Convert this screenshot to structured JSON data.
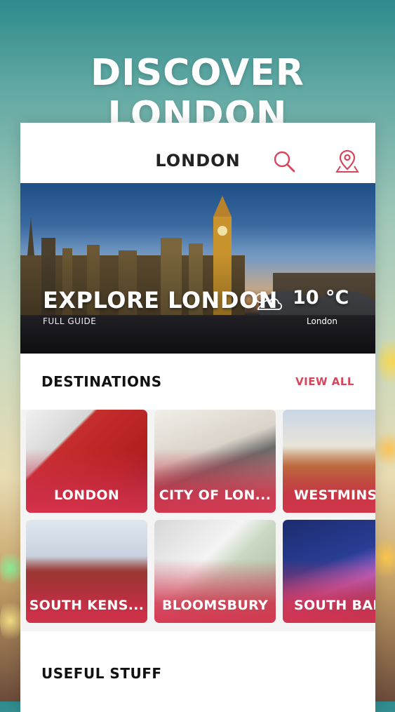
{
  "promo": {
    "title": "DISCOVER LONDON"
  },
  "appbar": {
    "title": "LONDON",
    "search_icon": "search-icon",
    "map_icon": "map-pin-icon"
  },
  "hero": {
    "title": "EXPLORE LONDON",
    "subtitle": "FULL GUIDE",
    "weather": {
      "temp": "10 °C",
      "city": "London",
      "icon": "cloud-sun-icon"
    }
  },
  "destinations": {
    "title": "DESTINATIONS",
    "view_all": "VIEW ALL",
    "items": [
      {
        "label": "LONDON"
      },
      {
        "label": "CITY OF LON..."
      },
      {
        "label": "WESTMINST"
      },
      {
        "label": "SOUTH KENS..."
      },
      {
        "label": "BLOOMSBURY"
      },
      {
        "label": "SOUTH BAN"
      }
    ]
  },
  "useful": {
    "title": "USEFUL STUFF"
  },
  "colors": {
    "accent": "#d6455b",
    "title_text": "#222222"
  }
}
